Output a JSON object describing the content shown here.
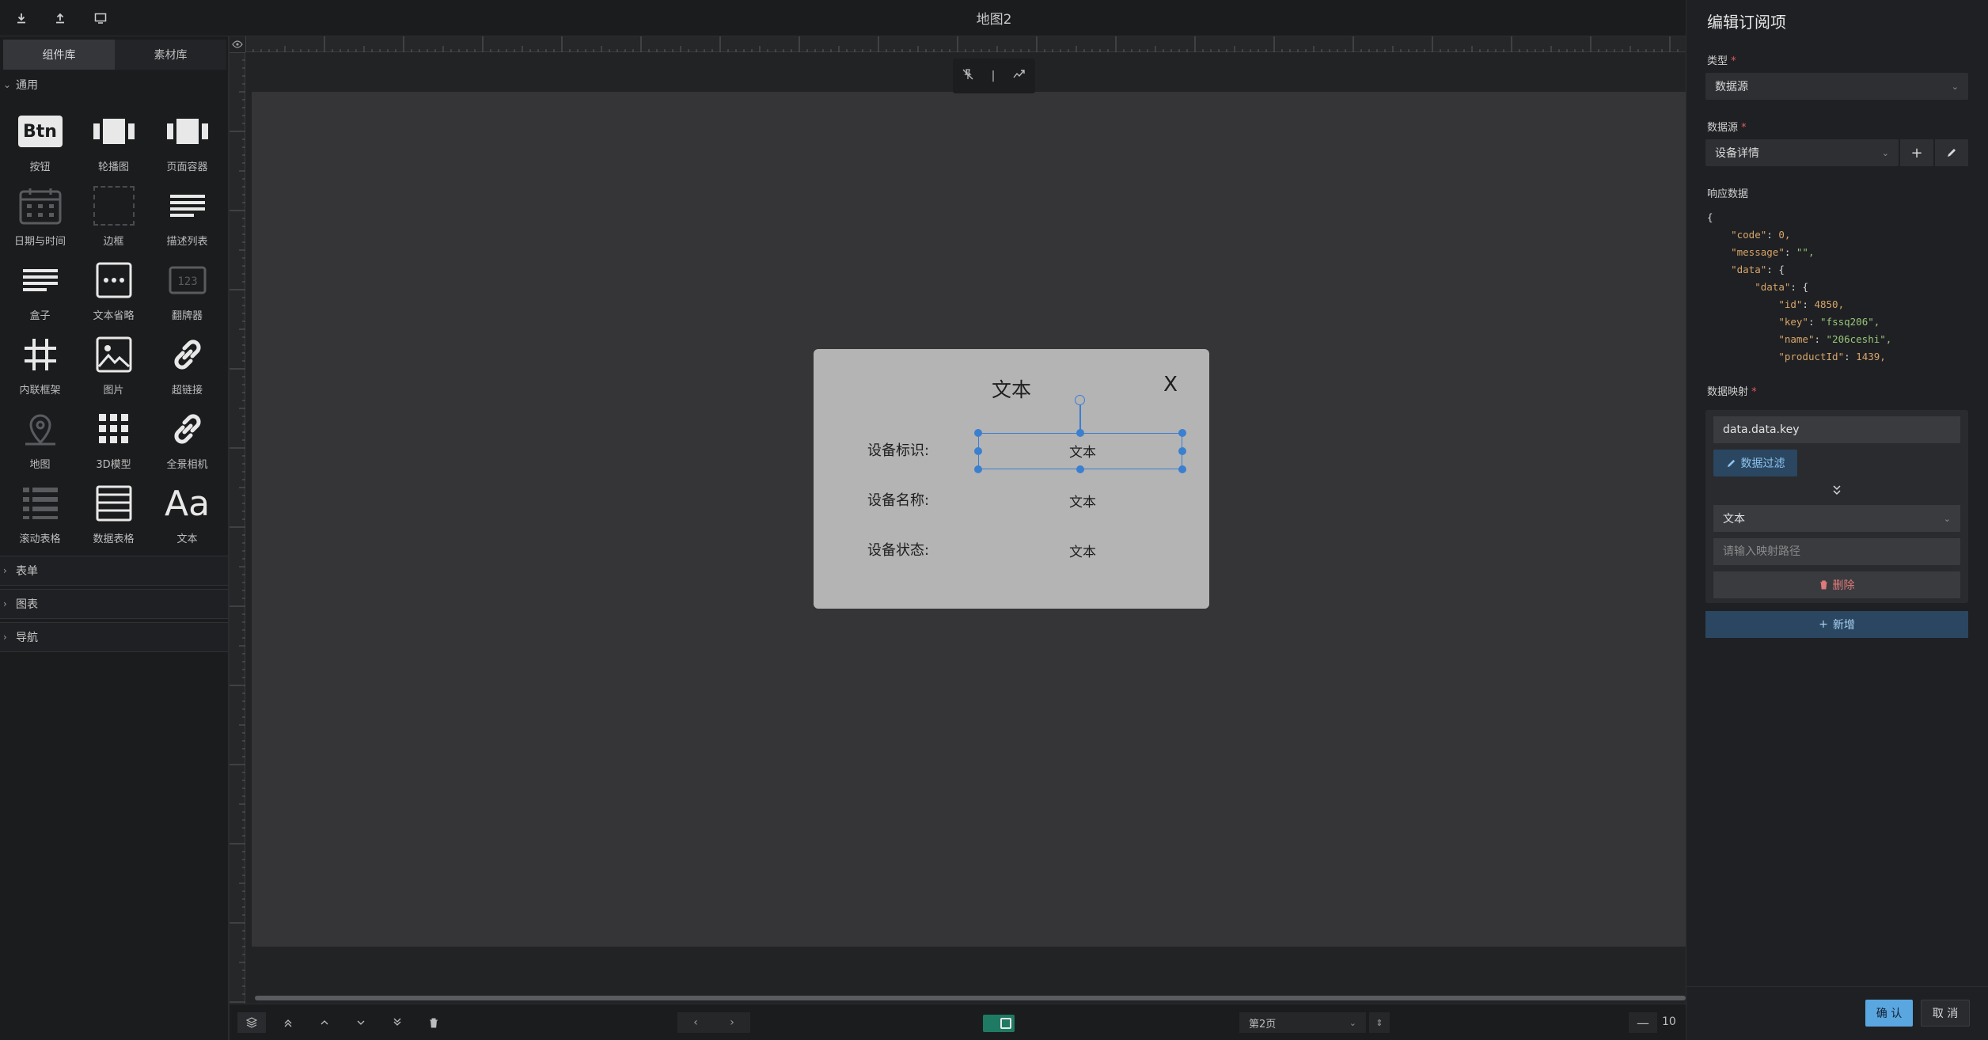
{
  "topbar": {
    "title": "地图2",
    "icons": [
      "download-icon",
      "upload-icon",
      "monitor-icon"
    ]
  },
  "library": {
    "tabs": [
      "组件库",
      "素材库"
    ],
    "active_tab": 0,
    "categories": {
      "general": "通用",
      "form": "表单",
      "chart": "图表",
      "nav": "导航"
    },
    "components": [
      {
        "label": "按钮",
        "icon": "button-icon"
      },
      {
        "label": "轮播图",
        "icon": "carousel-icon"
      },
      {
        "label": "页面容器",
        "icon": "page-container-icon"
      },
      {
        "label": "日期与时间",
        "icon": "calendar-icon"
      },
      {
        "label": "边框",
        "icon": "border-icon"
      },
      {
        "label": "描述列表",
        "icon": "list-icon"
      },
      {
        "label": "盒子",
        "icon": "box-icon"
      },
      {
        "label": "文本省略",
        "icon": "ellipsis-icon"
      },
      {
        "label": "翻牌器",
        "icon": "flipper-icon"
      },
      {
        "label": "内联框架",
        "icon": "iframe-icon"
      },
      {
        "label": "图片",
        "icon": "image-icon"
      },
      {
        "label": "超链接",
        "icon": "link-icon"
      },
      {
        "label": "地图",
        "icon": "map-pin-icon"
      },
      {
        "label": "3D模型",
        "icon": "grid-icon"
      },
      {
        "label": "全景相机",
        "icon": "link-icon"
      },
      {
        "label": "滚动表格",
        "icon": "scroll-table-icon"
      },
      {
        "label": "数据表格",
        "icon": "table-icon"
      },
      {
        "label": "文本",
        "icon": "text-icon"
      }
    ],
    "button_icon_text": "Btn",
    "text_icon_text": "Aa"
  },
  "stage": {
    "dialog": {
      "title": "文本",
      "close": "X",
      "rows": [
        {
          "label": "设备标识:",
          "value": "文本"
        },
        {
          "label": "设备名称:",
          "value": "文本"
        },
        {
          "label": "设备状态:",
          "value": "文本"
        }
      ]
    },
    "float_tool_sep": "|"
  },
  "bottombar": {
    "page": "第2页",
    "zoom": "10",
    "zoom_minus": "—"
  },
  "panel": {
    "title": "编辑订阅项",
    "type_label": "类型",
    "type_value": "数据源",
    "source_label": "数据源",
    "source_value": "设备详情",
    "source_add": "+",
    "response_label": "响应数据",
    "mapping_label": "数据映射",
    "mapping": {
      "path": "data.data.key",
      "filter_label": "数据过滤",
      "arrow": "⌄⌄",
      "target_type": "文本",
      "target_placeholder": "请输入映射路径",
      "delete_label": "删除"
    },
    "add_label": "新增",
    "ok_label": "确 认",
    "cancel_label": "取 消",
    "required_mark": "*"
  },
  "response_json": {
    "open": "{",
    "code_key": "\"code\"",
    "code_val": "0,",
    "message_key": "\"message\"",
    "message_val": "\"\",",
    "data_key": "\"data\"",
    "data_open": "{",
    "data2_key": "\"data\"",
    "data2_open": "{",
    "id_key": "\"id\"",
    "id_val": "4850,",
    "key_key": "\"key\"",
    "key_val": "\"fssq206\",",
    "name_key": "\"name\"",
    "name_val": "\"206ceshi\",",
    "pid_key": "\"productId\"",
    "pid_val": "1439,"
  },
  "colors": {
    "accent": "#3b7fd0",
    "primary_button": "#5aa6e0",
    "toggle": "#1f7a63",
    "danger": "#e07a7a"
  }
}
